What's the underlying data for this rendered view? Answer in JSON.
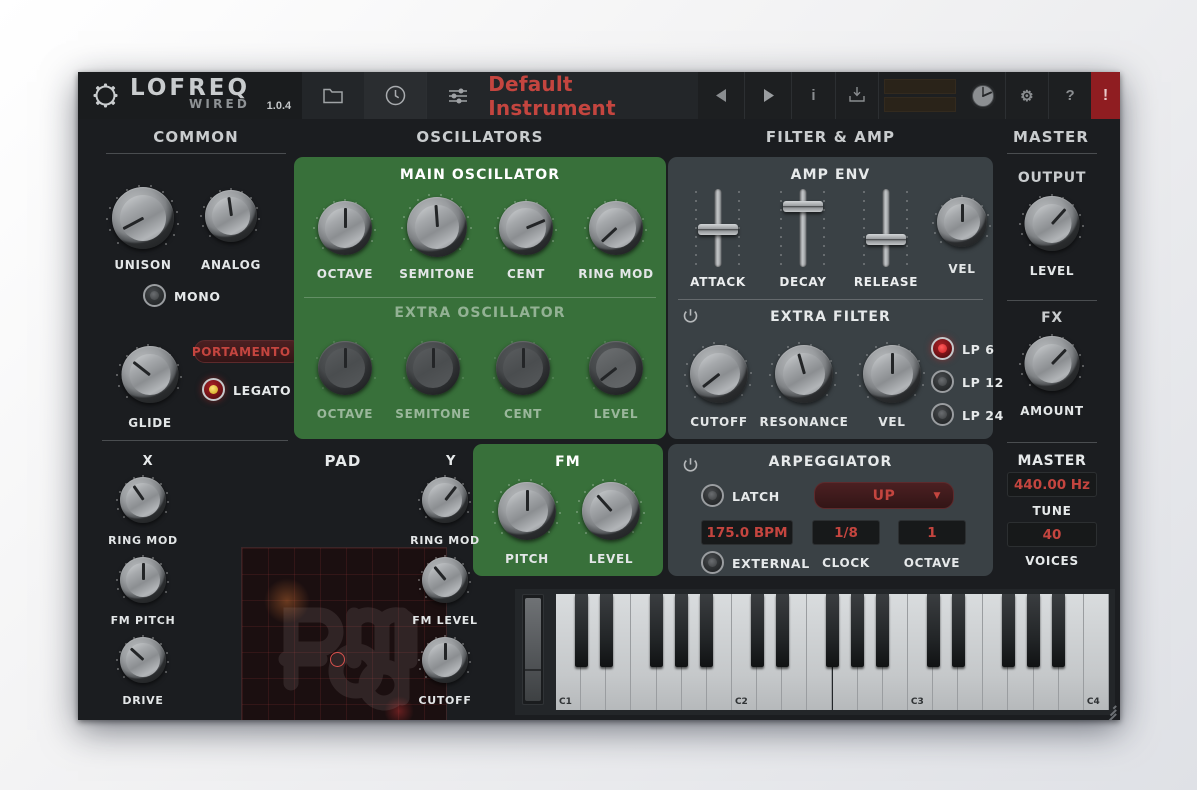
{
  "app": {
    "brand_line1": "LOFREQ",
    "brand_line2": "WIRED",
    "version": "1.0.4",
    "logo_icon": "cog-outline-icon"
  },
  "toolbar": {
    "browse_icon": "folder-icon",
    "clock_icon": "clock-icon",
    "mixer_icon": "sliders-icon",
    "preset_name": "Default Instrument",
    "prev_label": "◀",
    "next_label": "▶",
    "info_label": "i",
    "save_icon": "save-download-icon",
    "meter_name": "output-level-meter",
    "tuner_icon": "tuner-knob-icon",
    "settings_label": "⚙",
    "help_label": "?",
    "panic_label": "!"
  },
  "sections": {
    "common": "COMMON",
    "oscillators": "OSCILLATORS",
    "filter_amp": "FILTER & AMP",
    "master": "MASTER"
  },
  "common": {
    "unison": {
      "label": "UNISON",
      "angle": -118
    },
    "analog": {
      "label": "ANALOG",
      "angle": -8
    },
    "mono": {
      "label": "MONO",
      "on": false
    },
    "glide": {
      "label": "GLIDE",
      "angle": -52
    },
    "portamento": {
      "label": "PORTAMENTO",
      "caret": "▼"
    },
    "legato": {
      "label": "LEGATO",
      "on": true
    }
  },
  "oscillators": {
    "main_title": "MAIN OSCILLATOR",
    "main": [
      {
        "label": "OCTAVE",
        "angle": 0
      },
      {
        "label": "SEMITONE",
        "angle": -4
      },
      {
        "label": "CENT",
        "angle": 67
      },
      {
        "label": "RING MOD",
        "angle": -133
      }
    ],
    "extra_title": "EXTRA OSCILLATOR",
    "extra": [
      {
        "label": "OCTAVE",
        "angle": 0
      },
      {
        "label": "SEMITONE",
        "angle": 0
      },
      {
        "label": "CENT",
        "angle": 0
      },
      {
        "label": "LEVEL",
        "angle": -128
      }
    ],
    "fm_title": "FM",
    "fm": [
      {
        "label": "PITCH",
        "angle": 0
      },
      {
        "label": "LEVEL",
        "angle": -42
      }
    ]
  },
  "filter_amp": {
    "amp_env_title": "AMP ENV",
    "sliders": [
      {
        "label": "ATTACK",
        "pos": 52
      },
      {
        "label": "DECAY",
        "pos": 18
      },
      {
        "label": "RELEASE",
        "pos": 66
      }
    ],
    "amp_vel": {
      "label": "VEL",
      "angle": 0
    },
    "extra_filter_title": "EXTRA FILTER",
    "power_icon": "power-icon",
    "filter_knobs": [
      {
        "label": "CUTOFF",
        "angle": -128
      },
      {
        "label": "RESONANCE",
        "angle": -16
      },
      {
        "label": "VEL",
        "angle": 0
      }
    ],
    "slope_options": [
      {
        "label": "LP 6",
        "on": true
      },
      {
        "label": "LP 12",
        "on": false
      },
      {
        "label": "LP 24",
        "on": false
      }
    ]
  },
  "arpeggiator": {
    "title": "ARPEGGIATOR",
    "power_icon": "power-icon",
    "latch": {
      "label": "LATCH",
      "on": false
    },
    "mode": {
      "value": "UP",
      "caret": "▼"
    },
    "tempo": "175.0 BPM",
    "clock_value": "1/8",
    "clock_label": "CLOCK",
    "octave_value": "1",
    "octave_label": "OCTAVE",
    "external": {
      "label": "EXTERNAL",
      "on": false
    }
  },
  "master": {
    "output_title": "OUTPUT",
    "level": {
      "label": "LEVEL",
      "angle": 42
    },
    "fx_title": "FX",
    "amount": {
      "label": "AMOUNT",
      "angle": 44
    },
    "master_title": "MASTER",
    "tune_value": "440.00 Hz",
    "tune_label": "TUNE",
    "voices_value": "40",
    "voices_label": "VOICES"
  },
  "pad": {
    "title": "PAD",
    "x_title": "X",
    "y_title": "Y",
    "x_knobs": [
      {
        "label": "RING MOD",
        "angle": -35
      },
      {
        "label": "FM PITCH",
        "angle": 0
      },
      {
        "label": "DRIVE",
        "angle": -48
      }
    ],
    "y_knobs": [
      {
        "label": "RING MOD",
        "angle": 38
      },
      {
        "label": "FM LEVEL",
        "angle": -40
      },
      {
        "label": "CUTOFF",
        "angle": 0
      }
    ],
    "watermark": "rmtrod"
  },
  "keyboard": {
    "wheel_name": "mod-wheel",
    "octave_labels": [
      "C1",
      "C2",
      "C3",
      "C4"
    ]
  },
  "colors": {
    "accent_red": "#c4453f",
    "panel_green": "#38703a",
    "panel_gray": "#3a4145",
    "window_bg": "#1b1d20"
  }
}
